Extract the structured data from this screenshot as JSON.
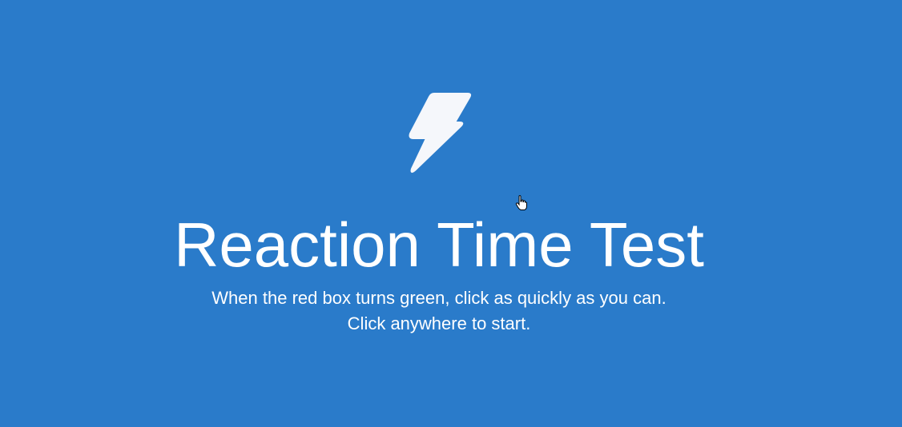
{
  "app": {
    "title": "Reaction Time Test",
    "instructions": [
      "When the red box turns green, click as quickly as you can.",
      "Click anywhere to start."
    ],
    "icon": "lightning-bolt-icon"
  },
  "colors": {
    "background": "#2a7bca",
    "text": "#ffffff",
    "icon": "#f5f7fb"
  }
}
